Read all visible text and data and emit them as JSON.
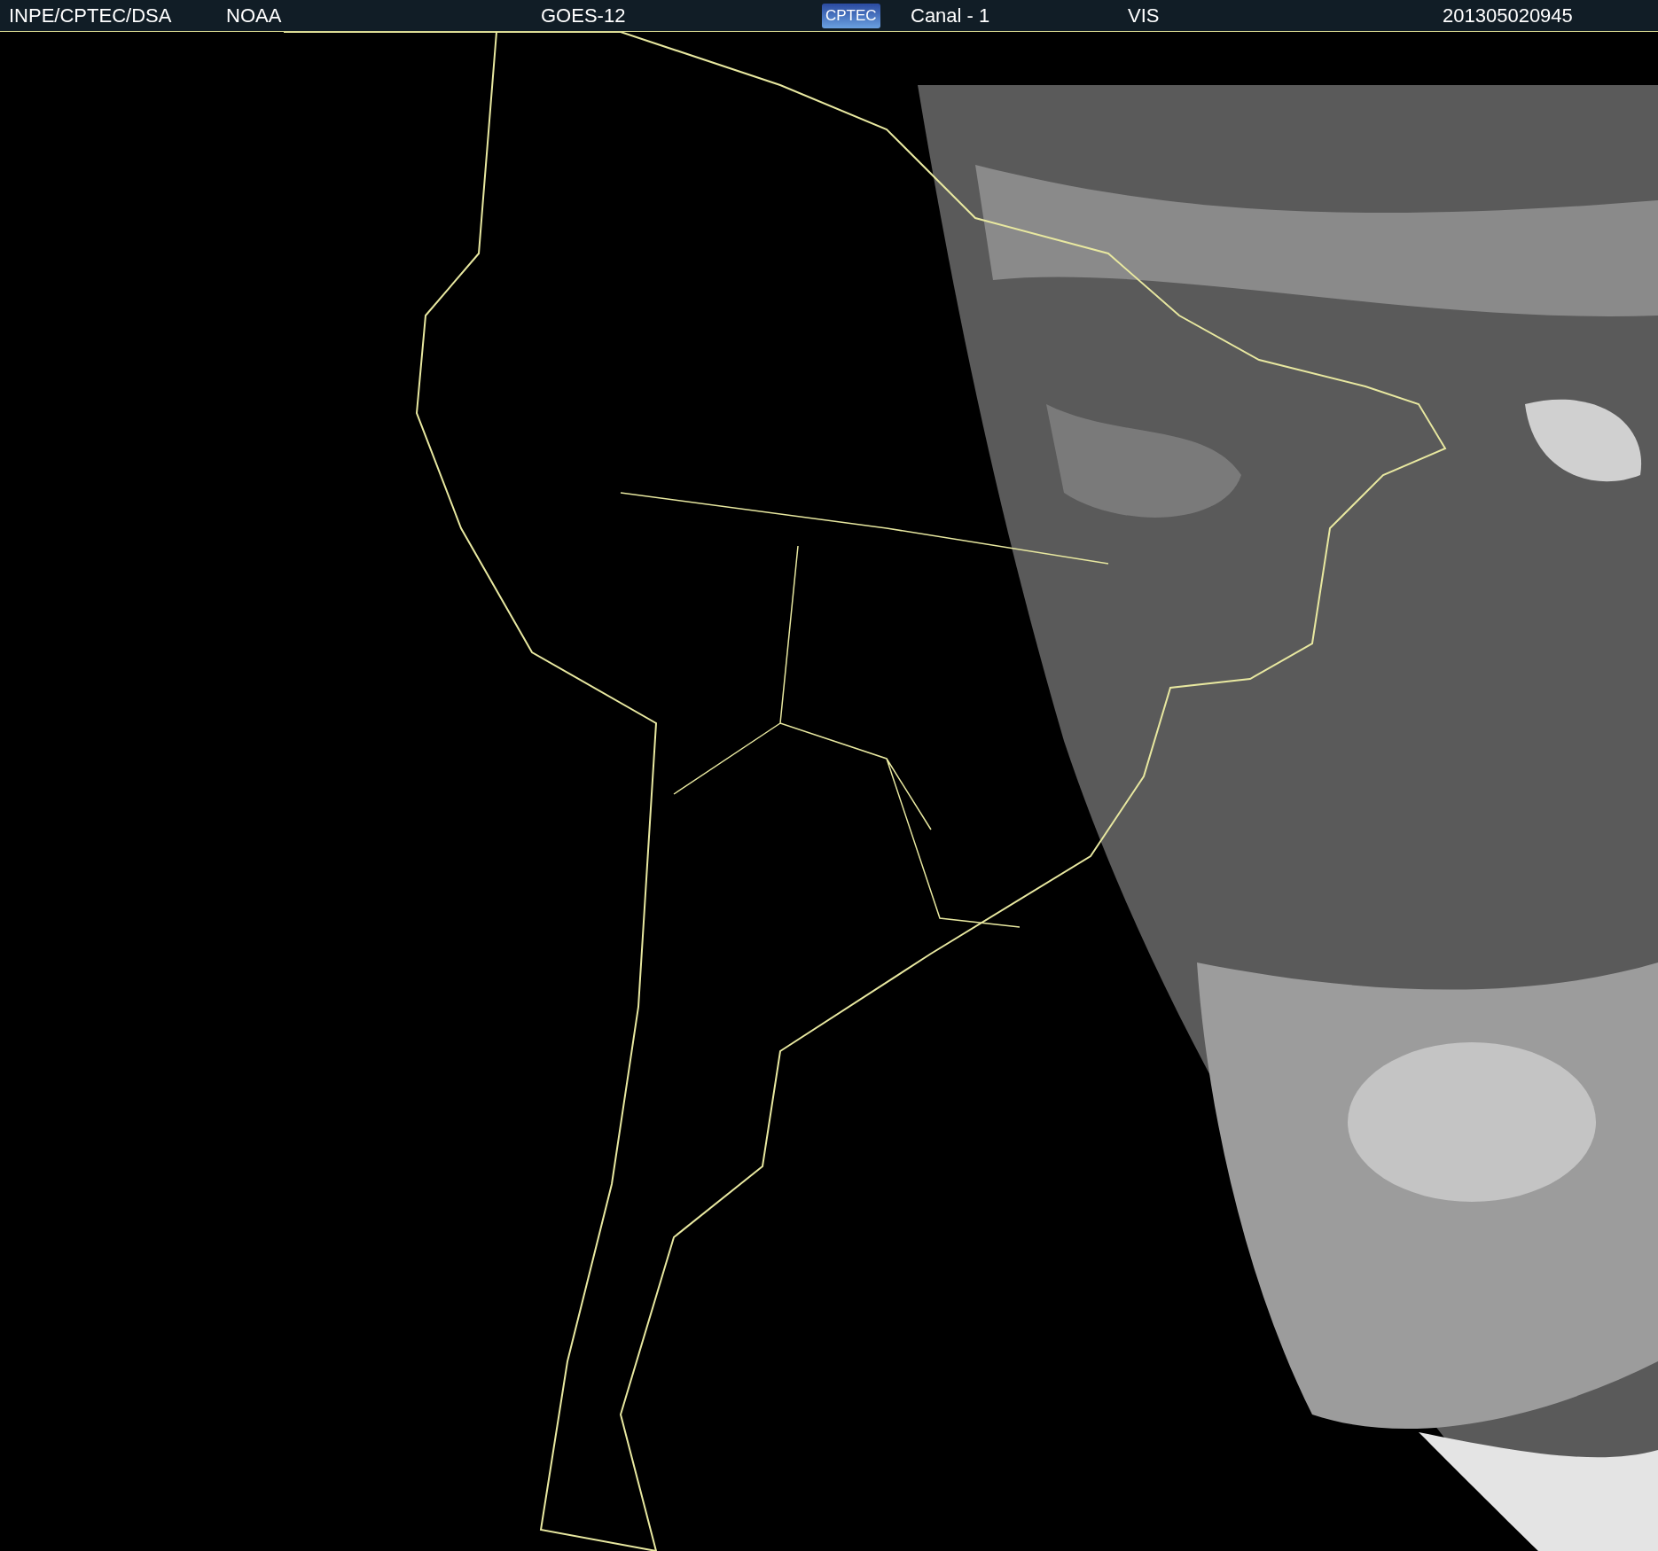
{
  "header": {
    "items": [
      {
        "kind": "text",
        "text": "INPE/CPTEC/DSA"
      },
      {
        "kind": "text",
        "text": "NOAA"
      },
      {
        "kind": "text",
        "text": "GOES-12"
      },
      {
        "kind": "logo",
        "text": "CPTEC"
      },
      {
        "kind": "text",
        "text": "Canal - 1"
      },
      {
        "kind": "text",
        "text": "VIS"
      },
      {
        "kind": "text",
        "text": "201305020945"
      }
    ]
  }
}
